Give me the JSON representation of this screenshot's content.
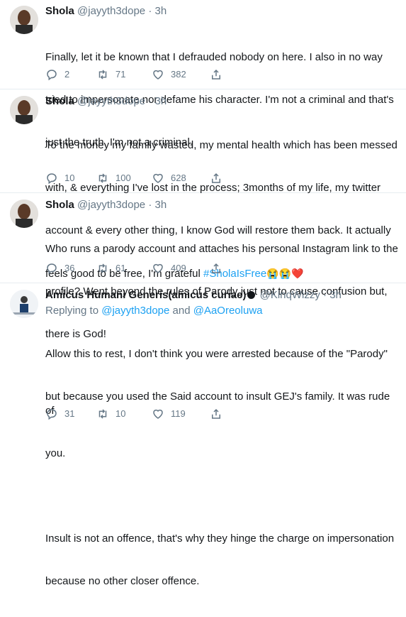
{
  "tweets": [
    {
      "name": "Shola",
      "handle": "@jayyth3dope",
      "time": "3h",
      "lines": [
        "Finally, let it be known that I defrauded nobody on here. I also in no way",
        "tried to impersonate nor defame his character. I'm not a criminal and that's",
        "just the truth. I'm not a criminal."
      ],
      "replies": "2",
      "retweets": "71",
      "likes": "382"
    },
    {
      "name": "Shola",
      "handle": "@jayyth3dope",
      "time": "3h",
      "lines": [
        "To the money my family wasted, my mental health which has been messed",
        "with, & everything I've lost in the process; 3months of my life, my twitter",
        "account & every other thing, I know God will restore them back. It actually"
      ],
      "last_line_text": "feels good to be free, I'm grateful ",
      "hashtag": "#SholaIsFree",
      "emojis": "😭😭❤️",
      "replies": "10",
      "retweets": "100",
      "likes": "628"
    },
    {
      "name": "Shola",
      "handle": "@jayyth3dope",
      "time": "3h",
      "lines": [
        "Who runs a parody account and attaches his personal Instagram link to the",
        "profile? Went beyond the rules of Parody just not to cause confusion but,",
        "there is God!"
      ],
      "replies": "36",
      "retweets": "61",
      "likes": "409"
    },
    {
      "name": "Amicus Humani Generis(amicus curiae)",
      "handle": "@KinqWizzy",
      "time": "3h",
      "replying_prefix": "Replying to ",
      "replying_user1": "@jayyth3dope",
      "replying_and": " and ",
      "replying_user2": "@AaOreoluwa",
      "lines": [
        "Allow this to rest, I don't think you were arrested because of the \"Parody\"",
        "but because you used the Said account to insult GEJ's family. It was rude of",
        "you.",
        "",
        "Insult is not an offence, that's why they hinge the charge on impersonation",
        "because no other closer offence."
      ],
      "replies": "31",
      "retweets": "10",
      "likes": "119"
    }
  ],
  "separator_dot": "·",
  "colors": {
    "link": "#1da1f2",
    "muted": "#657786",
    "text": "#14171a",
    "border": "#e6ecf0"
  },
  "icons": {
    "reply": "reply-icon",
    "retweet": "retweet-icon",
    "like": "heart-icon",
    "share": "share-icon"
  }
}
